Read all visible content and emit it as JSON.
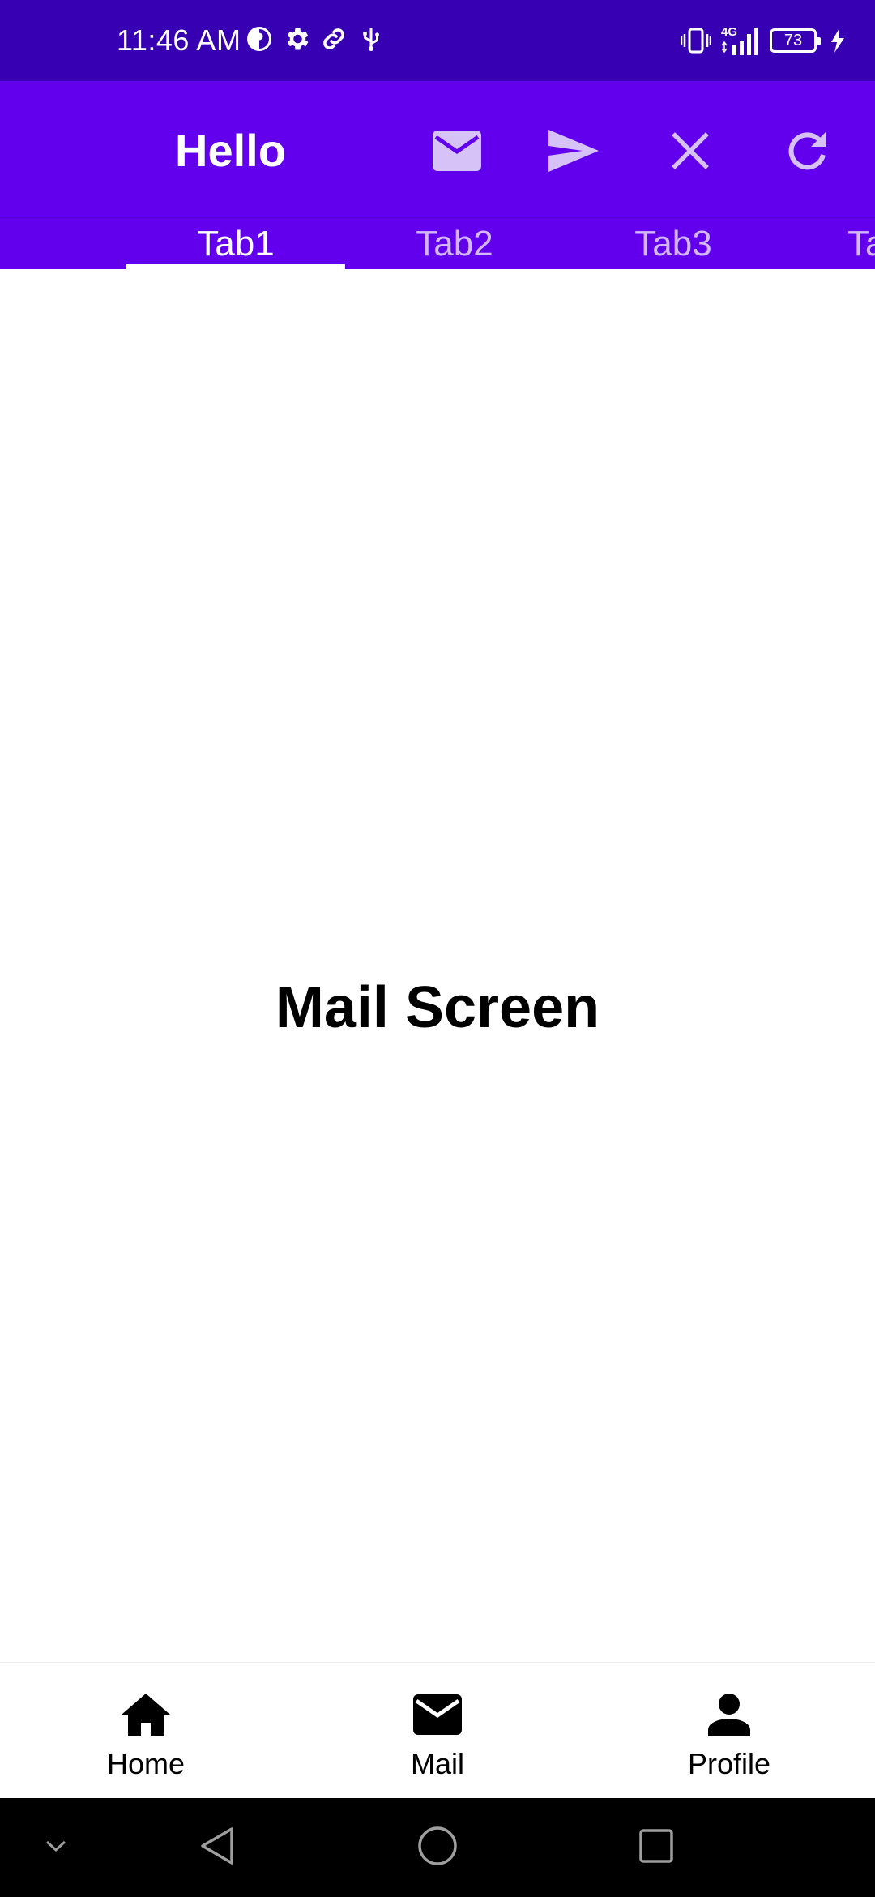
{
  "status_bar": {
    "time": "11:46 AM",
    "network": "4G",
    "battery": "73",
    "left_icons": [
      "pinwheel-icon",
      "gear-icon",
      "link-icon",
      "usb-icon"
    ],
    "right_icons": [
      "vibrate-icon",
      "signal-icon",
      "battery-icon",
      "charging-icon"
    ]
  },
  "app_bar": {
    "title": "Hello",
    "actions": [
      "mail-icon",
      "send-icon",
      "close-icon",
      "refresh-icon"
    ]
  },
  "tabs": {
    "items": [
      "Tab1",
      "Tab2",
      "Tab3",
      "Ta"
    ],
    "selected": "Tab1"
  },
  "content": {
    "title": "Mail Screen"
  },
  "bottom_nav": {
    "items": [
      {
        "label": "Home",
        "icon": "home-icon"
      },
      {
        "label": "Mail",
        "icon": "mail-icon"
      },
      {
        "label": "Profile",
        "icon": "person-icon"
      }
    ]
  },
  "system_nav": {
    "buttons": [
      "chevron-down-icon",
      "back-icon",
      "home-circle-icon",
      "recents-icon"
    ]
  },
  "colors": {
    "status_bar": "#3700B3",
    "app_bar": "#6200EE",
    "icon_tint": "#D7C2F7"
  }
}
